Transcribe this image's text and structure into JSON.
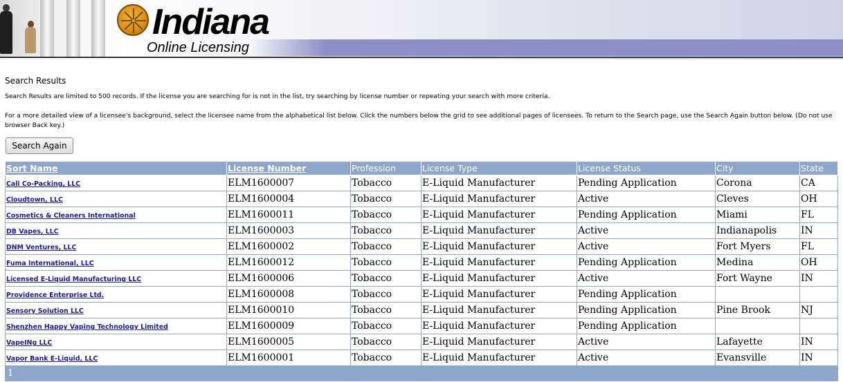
{
  "banner": {
    "logo_title": "Indiana",
    "logo_subtitle": "Online Licensing"
  },
  "page": {
    "heading": "Search Results",
    "note1": "Search Results are limited to 500 records. If the license you are searching for is not in the list, try searching by license number or repeating your search with more criteria.",
    "note2_line1": "For a more detailed view of a licensee's background, select the licensee name from the alphabetical list below. Click the numbers below the grid to see additional pages of licensees. To return to the Search page, use the Search Again button below. (Do not use",
    "note2_line2": "browser Back key.)",
    "search_again_label": "Search Again"
  },
  "table": {
    "headers": {
      "sort_name": "Sort Name",
      "license_number": "License Number",
      "profession": "Profession",
      "license_type": "License Type",
      "license_status": "License Status",
      "city": "City",
      "state": "State"
    },
    "rows": [
      {
        "name": "Cali Co-Packing, LLC",
        "number": "ELM1600007",
        "profession": "Tobacco",
        "type": "E-Liquid Manufacturer",
        "status": "Pending Application",
        "city": "Corona",
        "state": "CA"
      },
      {
        "name": "Cloudtown, LLC",
        "number": "ELM1600004",
        "profession": "Tobacco",
        "type": "E-Liquid Manufacturer",
        "status": "Active",
        "city": "Cleves",
        "state": "OH"
      },
      {
        "name": "Cosmetics & Cleaners International",
        "number": "ELM1600011",
        "profession": "Tobacco",
        "type": "E-Liquid Manufacturer",
        "status": "Pending Application",
        "city": "Miami",
        "state": "FL"
      },
      {
        "name": "DB Vapes, LLC",
        "number": "ELM1600003",
        "profession": "Tobacco",
        "type": "E-Liquid Manufacturer",
        "status": "Active",
        "city": "Indianapolis",
        "state": "IN"
      },
      {
        "name": "DNM Ventures, LLC",
        "number": "ELM1600002",
        "profession": "Tobacco",
        "type": "E-Liquid Manufacturer",
        "status": "Active",
        "city": "Fort Myers",
        "state": "FL"
      },
      {
        "name": "Fuma International, LLC",
        "number": "ELM1600012",
        "profession": "Tobacco",
        "type": "E-Liquid Manufacturer",
        "status": "Pending Application",
        "city": "Medina",
        "state": "OH"
      },
      {
        "name": "Licensed E-Liquid Manufacturing LLC",
        "number": "ELM1600006",
        "profession": "Tobacco",
        "type": "E-Liquid Manufacturer",
        "status": "Active",
        "city": "Fort Wayne",
        "state": "IN"
      },
      {
        "name": "Providence Enterprise Ltd.",
        "number": "ELM1600008",
        "profession": "Tobacco",
        "type": "E-Liquid Manufacturer",
        "status": "Pending Application",
        "city": "",
        "state": ""
      },
      {
        "name": "Sensory Solution LLC",
        "number": "ELM1600010",
        "profession": "Tobacco",
        "type": "E-Liquid Manufacturer",
        "status": "Pending Application",
        "city": "Pine Brook",
        "state": "NJ"
      },
      {
        "name": "Shenzhen Happy Vaping Technology Limited",
        "number": "ELM1600009",
        "profession": "Tobacco",
        "type": "E-Liquid Manufacturer",
        "status": "Pending Application",
        "city": "",
        "state": ""
      },
      {
        "name": "VapeINg LLC",
        "number": "ELM1600005",
        "profession": "Tobacco",
        "type": "E-Liquid Manufacturer",
        "status": "Active",
        "city": "Lafayette",
        "state": "IN"
      },
      {
        "name": "Vapor Bank E-Liquid, LLC",
        "number": "ELM1600001",
        "profession": "Tobacco",
        "type": "E-Liquid Manufacturer",
        "status": "Active",
        "city": "Evansville",
        "state": "IN"
      }
    ],
    "pager": [
      "1"
    ]
  },
  "colors": {
    "header_bg": "#8ea6c9",
    "link": "#1a1a99",
    "banner_band": "#8e8ec6"
  },
  "icons": [
    "indiana-seal-icon"
  ]
}
